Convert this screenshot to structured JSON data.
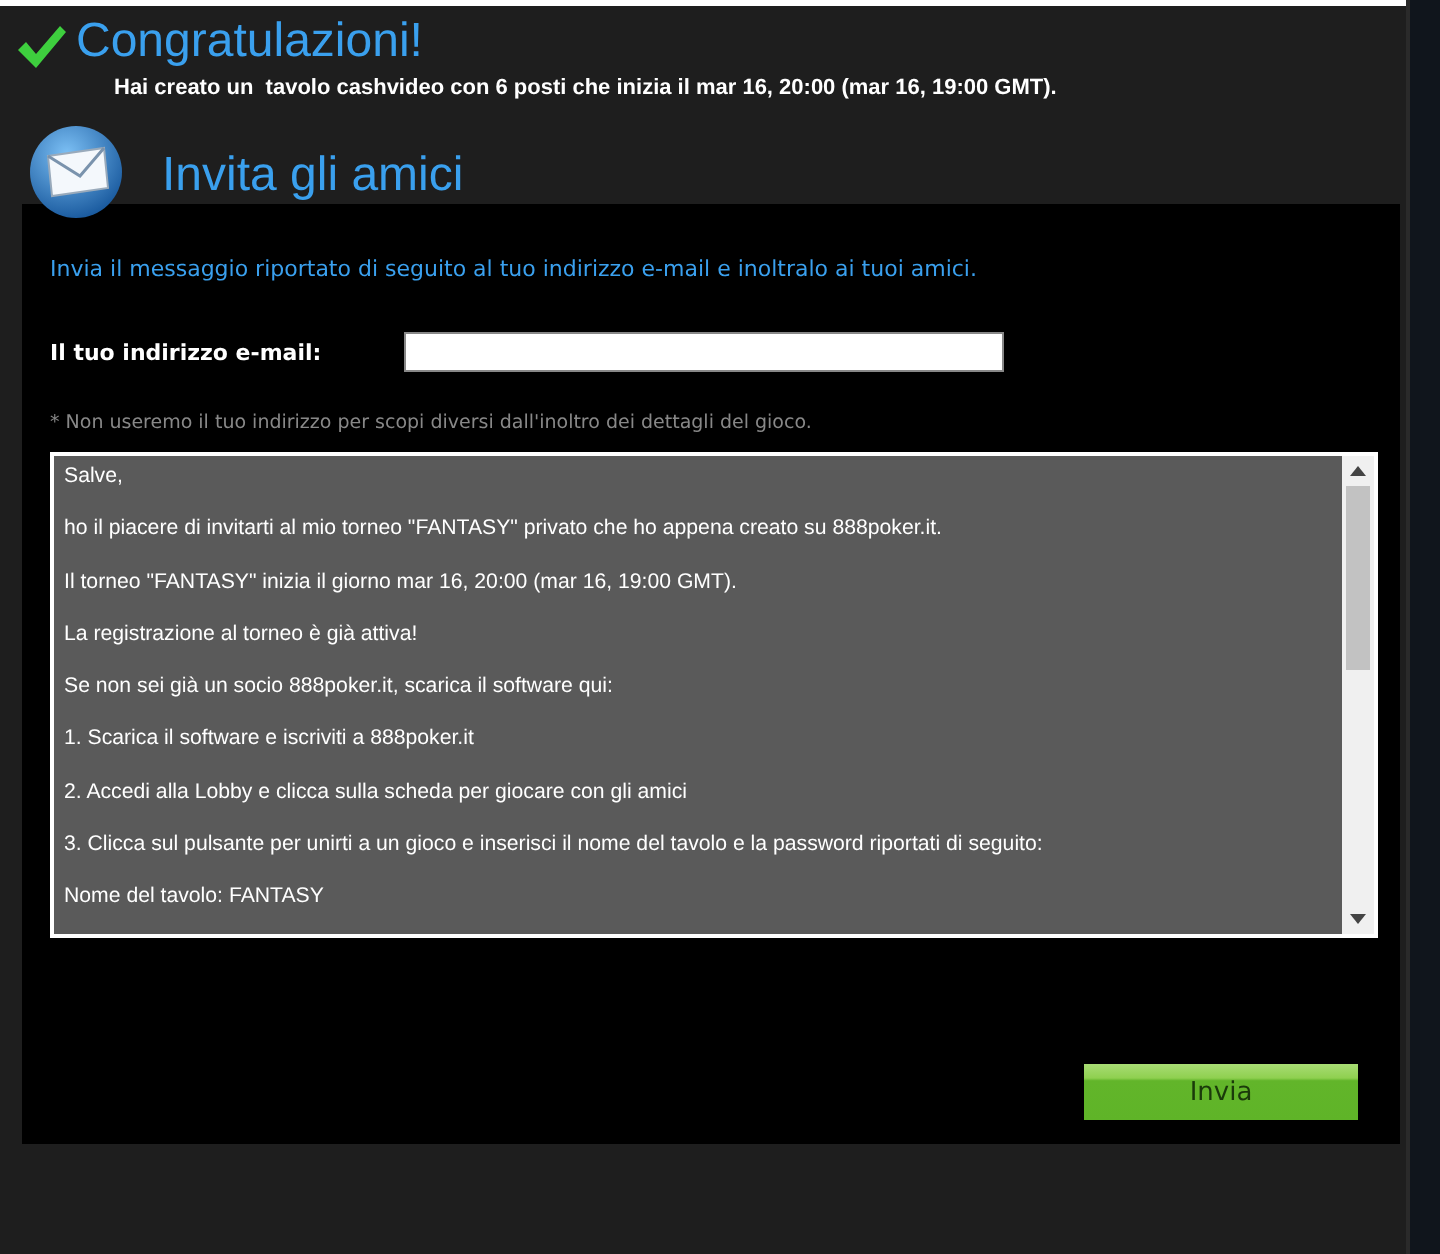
{
  "header": {
    "title": "Congratulazioni!",
    "message": "Hai creato un  tavolo cashvideo con 6 posti che inizia il mar 16, 20:00 (mar 16, 19:00 GMT)."
  },
  "invite": {
    "title": "Invita gli amici",
    "instructions": "Invia il messaggio riportato di seguito al tuo indirizzo e-mail e inoltralo ai tuoi amici.",
    "email_label": "Il tuo indirizzo e-mail:",
    "note": "* Non useremo il tuo indirizzo per scopi diversi dall'inoltro dei dettagli del gioco.",
    "message_lines": [
      "Salve,",
      "ho il piacere di invitarti al mio torneo \"FANTASY\" privato che ho appena creato su 888poker.it.",
      "Il torneo \"FANTASY\" inizia il giorno mar 16, 20:00 (mar 16, 19:00 GMT).",
      "La registrazione al torneo è già attiva!",
      "Se non sei già un socio 888poker.it, scarica il software qui:",
      "1. Scarica il software e iscriviti a 888poker.it",
      "2. Accedi alla Lobby e clicca sulla scheda per giocare con gli amici",
      "3. Clicca sul pulsante per unirti a un gioco e inserisci il nome del tavolo e la password riportati di seguito:",
      "Nome del tavolo: FANTASY"
    ],
    "send_button": "Invia"
  }
}
